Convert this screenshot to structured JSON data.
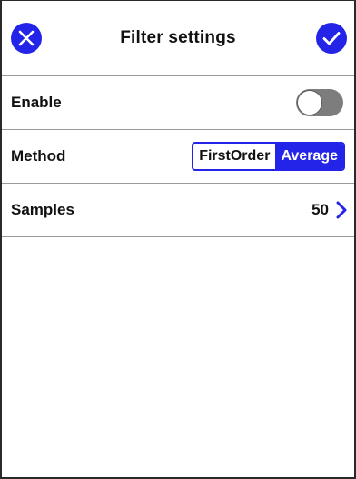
{
  "header": {
    "title": "Filter settings",
    "cancel_icon": "close-icon",
    "confirm_icon": "check-icon"
  },
  "rows": {
    "enable": {
      "label": "Enable",
      "toggle_on": false
    },
    "method": {
      "label": "Method",
      "options": [
        "FirstOrder",
        "Average"
      ],
      "selected": "Average"
    },
    "samples": {
      "label": "Samples",
      "value": "50",
      "icon": "chevron-right-icon"
    }
  },
  "colors": {
    "accent": "#2424e8",
    "toggle_off": "#7d7d7d",
    "divider": "#9a9a9a"
  }
}
